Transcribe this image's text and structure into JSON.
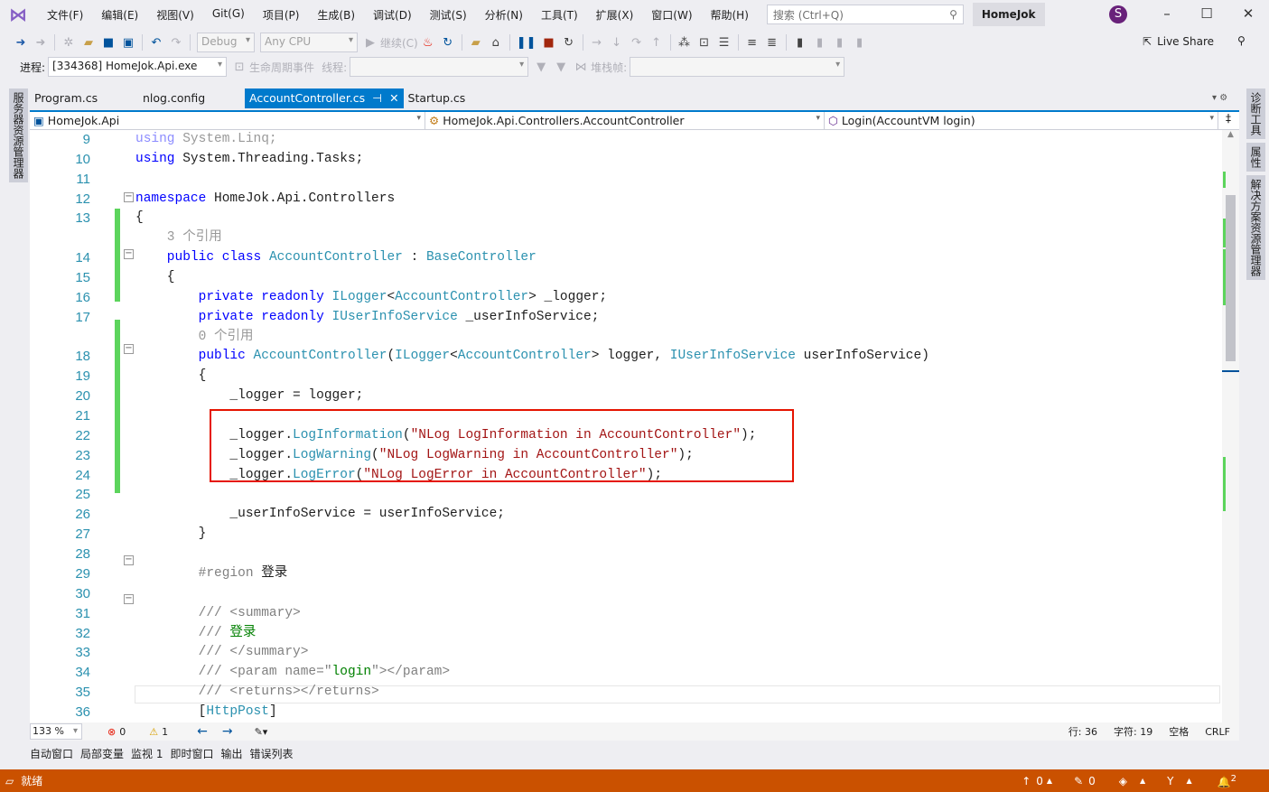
{
  "menubar": {
    "items": [
      "文件(F)",
      "编辑(E)",
      "视图(V)",
      "Git(G)",
      "项目(P)",
      "生成(B)",
      "调试(D)",
      "测试(S)",
      "分析(N)",
      "工具(T)",
      "扩展(X)",
      "窗口(W)",
      "帮助(H)"
    ],
    "search_placeholder": "搜索 (Ctrl+Q)",
    "project": "HomeJok",
    "avatar": "S"
  },
  "toolbar": {
    "config": "Debug",
    "platform": "Any CPU",
    "continue": "继续(C)",
    "live_share": "Live Share"
  },
  "debugbar": {
    "process_label": "进程:",
    "process": "[334368] HomeJok.Api.exe",
    "lifecycle": "生命周期事件",
    "thread_label": "线程:",
    "stack_label": "堆栈帧:"
  },
  "tabs": [
    {
      "label": "Program.cs"
    },
    {
      "label": "nlog.config"
    },
    {
      "label": "AccountController.cs",
      "active": true
    },
    {
      "label": "Startup.cs"
    }
  ],
  "navbar": {
    "project": "HomeJok.Api",
    "class": "HomeJok.Api.Controllers.AccountController",
    "member": "Login(AccountVM login)"
  },
  "side": {
    "left": "服务器资源管理器",
    "right": [
      "诊断工具",
      "属性",
      "解决方案资源管理器"
    ]
  },
  "code": {
    "lines": [
      {
        "n": "9",
        "t": [
          [
            "fk",
            "using"
          ],
          [
            "fp",
            " System.Linq;"
          ]
        ]
      },
      {
        "n": "10",
        "t": [
          [
            "kw",
            "using"
          ],
          [
            "",
            " System.Threading.Tasks;"
          ]
        ]
      },
      {
        "n": "11",
        "t": []
      },
      {
        "n": "12",
        "t": [
          [
            "kw",
            "namespace"
          ],
          [
            "",
            " HomeJok.Api.Controllers"
          ]
        ]
      },
      {
        "n": "13",
        "t": [
          [
            "",
            "{"
          ]
        ]
      },
      {
        "n": "",
        "t": [
          [
            "rf",
            "    3 个引用"
          ]
        ]
      },
      {
        "n": "14",
        "t": [
          [
            "kw",
            "    public class "
          ],
          [
            "ty",
            "AccountController"
          ],
          [
            "",
            " : "
          ],
          [
            "ty",
            "BaseController"
          ]
        ]
      },
      {
        "n": "15",
        "t": [
          [
            "",
            "    {"
          ]
        ]
      },
      {
        "n": "16",
        "t": [
          [
            "kw",
            "        private readonly "
          ],
          [
            "ty",
            "ILogger"
          ],
          [
            "",
            "<"
          ],
          [
            "ty",
            "AccountController"
          ],
          [
            "",
            "> _logger;"
          ]
        ]
      },
      {
        "n": "17",
        "t": [
          [
            "kw",
            "        private readonly "
          ],
          [
            "ty",
            "IUserInfoService"
          ],
          [
            "",
            " _userInfoService;"
          ]
        ]
      },
      {
        "n": "",
        "t": [
          [
            "rf",
            "        0 个引用"
          ]
        ]
      },
      {
        "n": "18",
        "t": [
          [
            "kw",
            "        public "
          ],
          [
            "ty",
            "AccountController"
          ],
          [
            "",
            "("
          ],
          [
            "ty",
            "ILogger"
          ],
          [
            "",
            "<"
          ],
          [
            "ty",
            "AccountController"
          ],
          [
            "",
            "> logger, "
          ],
          [
            "ty",
            "IUserInfoService"
          ],
          [
            "",
            " userInfoService)"
          ]
        ]
      },
      {
        "n": "19",
        "t": [
          [
            "",
            "        {"
          ]
        ]
      },
      {
        "n": "20",
        "t": [
          [
            "",
            "            _logger = logger;"
          ]
        ]
      },
      {
        "n": "21",
        "t": []
      },
      {
        "n": "22",
        "t": [
          [
            "",
            "            _logger."
          ],
          [
            "ty",
            "LogInformation"
          ],
          [
            "",
            "("
          ],
          [
            "st",
            "\"NLog LogInformation in AccountController\""
          ],
          [
            "",
            ");"
          ]
        ]
      },
      {
        "n": "23",
        "t": [
          [
            "",
            "            _logger."
          ],
          [
            "ty",
            "LogWarning"
          ],
          [
            "",
            "("
          ],
          [
            "st",
            "\"NLog LogWarning in AccountController\""
          ],
          [
            "",
            ");"
          ]
        ]
      },
      {
        "n": "24",
        "t": [
          [
            "",
            "            _logger."
          ],
          [
            "ty",
            "LogError"
          ],
          [
            "",
            "("
          ],
          [
            "st",
            "\"NLog LogError in AccountController\""
          ],
          [
            "",
            ");"
          ]
        ]
      },
      {
        "n": "25",
        "t": []
      },
      {
        "n": "26",
        "t": [
          [
            "",
            "            _userInfoService = userInfoService;"
          ]
        ]
      },
      {
        "n": "27",
        "t": [
          [
            "",
            "        }"
          ]
        ]
      },
      {
        "n": "28",
        "t": []
      },
      {
        "n": "29",
        "t": [
          [
            "rg",
            "        #region "
          ],
          [
            "",
            "登录"
          ]
        ]
      },
      {
        "n": "30",
        "t": []
      },
      {
        "n": "31",
        "t": [
          [
            "cm",
            "        /// <summary>"
          ]
        ]
      },
      {
        "n": "32",
        "t": [
          [
            "cm",
            "        /// "
          ],
          [
            "cmg",
            "登录"
          ]
        ]
      },
      {
        "n": "33",
        "t": [
          [
            "cm",
            "        /// </summary>"
          ]
        ]
      },
      {
        "n": "34",
        "t": [
          [
            "cm",
            "        /// <param name=\""
          ],
          [
            "cmg",
            "login"
          ],
          [
            "cm",
            "\"></param>"
          ]
        ]
      },
      {
        "n": "35",
        "t": [
          [
            "cm",
            "        /// <returns></returns>"
          ]
        ]
      },
      {
        "n": "36",
        "t": [
          [
            "",
            "        ["
          ],
          [
            "ty",
            "HttpPost"
          ],
          [
            "",
            "]"
          ]
        ]
      },
      {
        "n": "",
        "t": [
          [
            "rf",
            "        0 个引用"
          ]
        ]
      }
    ]
  },
  "status": {
    "zoom": "133 %",
    "errors": "0",
    "warnings": "1",
    "line": "行: 36",
    "char": "字符: 19",
    "spaces": "空格",
    "eol": "CRLF"
  },
  "bottom_tabs": [
    "自动窗口",
    "局部变量",
    "监视 1",
    "即时窗口",
    "输出",
    "错误列表"
  ],
  "statusbar": {
    "ready": "就绪",
    "up": "0",
    "edits": "0",
    "notifications": "2"
  },
  "colors": {
    "accent": "#007acc",
    "statusbar": "#ca5100",
    "change_bar": "#5cd45c",
    "highlight_box": "#e51400"
  }
}
